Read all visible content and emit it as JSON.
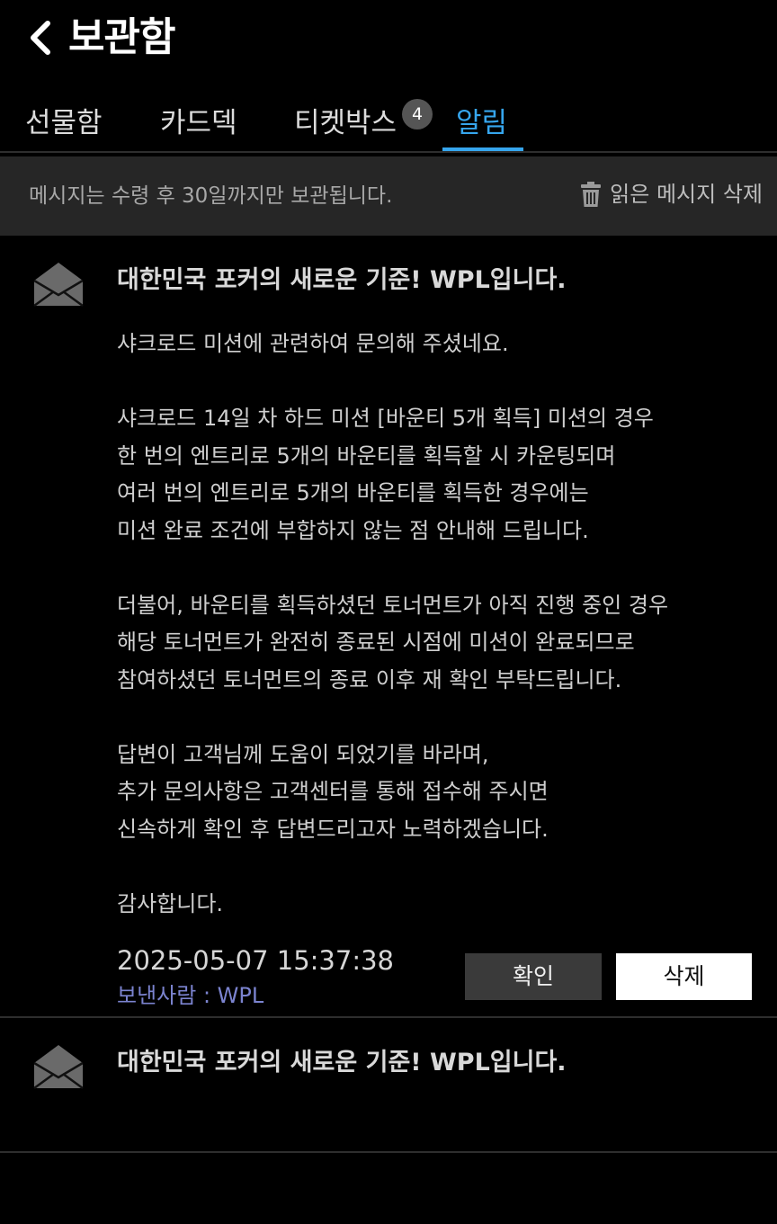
{
  "header": {
    "title": "보관함",
    "back_icon": "chevron-left-icon"
  },
  "tabs": [
    {
      "label": "선물함",
      "active": false
    },
    {
      "label": "카드덱",
      "active": false
    },
    {
      "label": "티켓박스",
      "active": false,
      "badge": "4"
    },
    {
      "label": "알림",
      "active": true
    }
  ],
  "colors": {
    "accent": "#36a6ee",
    "sender": "#7b83cf",
    "info_bar": "#262626"
  },
  "info_bar": {
    "notice": "메시지는 수령 후 30일까지만 보관됩니다.",
    "delete_read_label": "읽은 메시지 삭제",
    "delete_icon": "trash-icon"
  },
  "messages": [
    {
      "title": "대한민국 포커의 새로운 기준! WPL입니다.",
      "icon": "envelope-open-icon",
      "body": [
        "샤크로드 미션에 관련하여 문의해 주셨네요.",
        "",
        "샤크로드 14일 차 하드 미션 [바운티 5개 획득] 미션의 경우",
        "한 번의 엔트리로 5개의 바운티를 획득할 시 카운팅되며",
        "여러 번의 엔트리로 5개의 바운티를 획득한 경우에는",
        "미션 완료 조건에 부합하지 않는 점 안내해 드립니다.",
        "",
        "더불어, 바운티를 획득하셨던 토너먼트가 아직 진행 중인 경우",
        "해당 토너먼트가 완전히 종료된 시점에 미션이 완료되므로",
        "참여하셨던 토너먼트의 종료 이후 재 확인 부탁드립니다.",
        "",
        "답변이 고객님께 도움이 되었기를 바라며,",
        "추가 문의사항은 고객센터를 통해 접수해 주시면",
        "신속하게 확인 후 답변드리고자 노력하겠습니다.",
        "",
        "감사합니다."
      ],
      "date": "2025-05-07 15:37:38",
      "sender": "보낸사람 : WPL",
      "confirm_label": "확인",
      "delete_label": "삭제"
    },
    {
      "title": "대한민국 포커의 새로운 기준! WPL입니다.",
      "icon": "envelope-open-icon"
    }
  ]
}
